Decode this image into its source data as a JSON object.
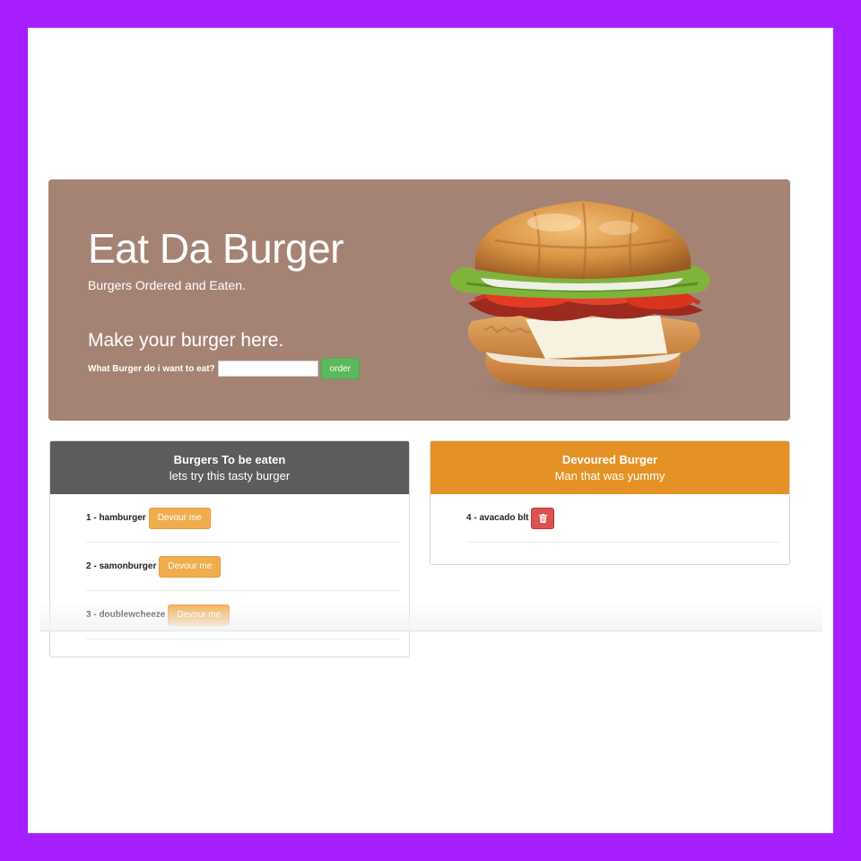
{
  "hero": {
    "title": "Eat Da Burger",
    "subtitle": "Burgers Ordered and Eaten.",
    "form_heading": "Make your burger here.",
    "input_label": "What Burger do i want to eat?",
    "input_value": "",
    "order_button": "order",
    "image": "burger-photo"
  },
  "to_eat": {
    "title": "Burgers To be eaten",
    "subtitle": "lets try this tasty burger",
    "devour_label": "Devour me",
    "items": [
      {
        "label": "1 - hamburger"
      },
      {
        "label": "2 - samonburger"
      },
      {
        "label": "3 - doublewcheeze"
      }
    ]
  },
  "devoured": {
    "title": "Devoured Burger",
    "subtitle": "Man that was yummy",
    "delete_icon": "trash-icon",
    "items": [
      {
        "label": "4 - avacado blt"
      }
    ]
  },
  "colors": {
    "page_border": "#a71fff",
    "hero_bg": "#a58374",
    "to_eat_header": "#5c5c5c",
    "devoured_header": "#e49225",
    "devour_button": "#f0ad4e",
    "order_button": "#5cb85c",
    "delete_button": "#d9534f"
  }
}
